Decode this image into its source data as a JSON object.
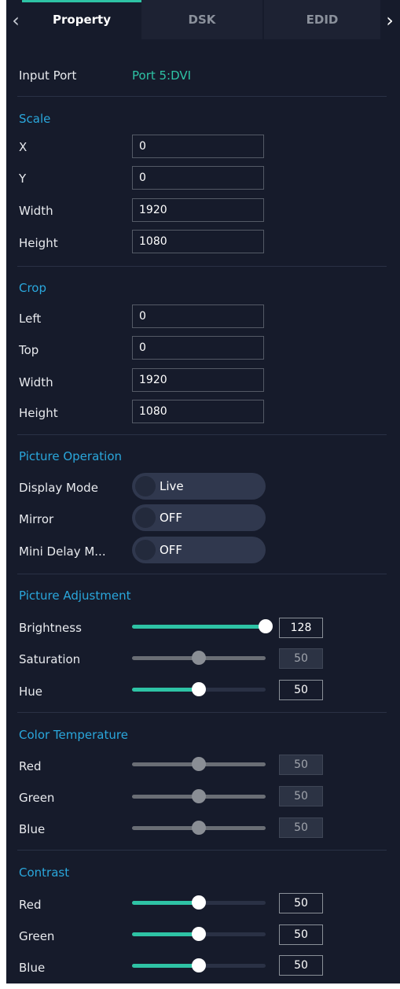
{
  "tabs": {
    "left_arrow": "‹",
    "right_arrow": "›",
    "items": [
      "Property",
      "DSK",
      "EDID"
    ],
    "active": "Property"
  },
  "input_port": {
    "label": "Input Port",
    "value": "Port 5:DVI"
  },
  "scale": {
    "title": "Scale",
    "x": {
      "label": "X",
      "value": "0"
    },
    "y": {
      "label": "Y",
      "value": "0"
    },
    "width": {
      "label": "Width",
      "value": "1920"
    },
    "height": {
      "label": "Height",
      "value": "1080"
    }
  },
  "crop": {
    "title": "Crop",
    "left": {
      "label": "Left",
      "value": "0"
    },
    "top": {
      "label": "Top",
      "value": "0"
    },
    "width": {
      "label": "Width",
      "value": "1920"
    },
    "height": {
      "label": "Height",
      "value": "1080"
    }
  },
  "picture_operation": {
    "title": "Picture Operation",
    "display_mode": {
      "label": "Display Mode",
      "value": "Live"
    },
    "mirror": {
      "label": "Mirror",
      "value": "OFF"
    },
    "mini_delay": {
      "label": "Mini Delay M...",
      "value": "OFF"
    }
  },
  "picture_adjustment": {
    "title": "Picture Adjustment",
    "brightness": {
      "label": "Brightness",
      "value": "128",
      "fraction": 1.0,
      "enabled": true
    },
    "saturation": {
      "label": "Saturation",
      "value": "50",
      "fraction": 0.5,
      "enabled": false
    },
    "hue": {
      "label": "Hue",
      "value": "50",
      "fraction": 0.5,
      "enabled": true
    }
  },
  "color_temperature": {
    "title": "Color Temperature",
    "red": {
      "label": "Red",
      "value": "50",
      "fraction": 0.5,
      "enabled": false
    },
    "green": {
      "label": "Green",
      "value": "50",
      "fraction": 0.5,
      "enabled": false
    },
    "blue": {
      "label": "Blue",
      "value": "50",
      "fraction": 0.5,
      "enabled": false
    }
  },
  "contrast": {
    "title": "Contrast",
    "red": {
      "label": "Red",
      "value": "50",
      "fraction": 0.5,
      "enabled": true
    },
    "green": {
      "label": "Green",
      "value": "50",
      "fraction": 0.5,
      "enabled": true
    },
    "blue": {
      "label": "Blue",
      "value": "50",
      "fraction": 0.5,
      "enabled": true
    }
  },
  "colors": {
    "accent": "#2ec3a5",
    "section_title": "#2aa7dc",
    "panel_bg": "#161b2b",
    "slider_on_track": "#2a3145",
    "slider_off": "#6a6e75"
  }
}
